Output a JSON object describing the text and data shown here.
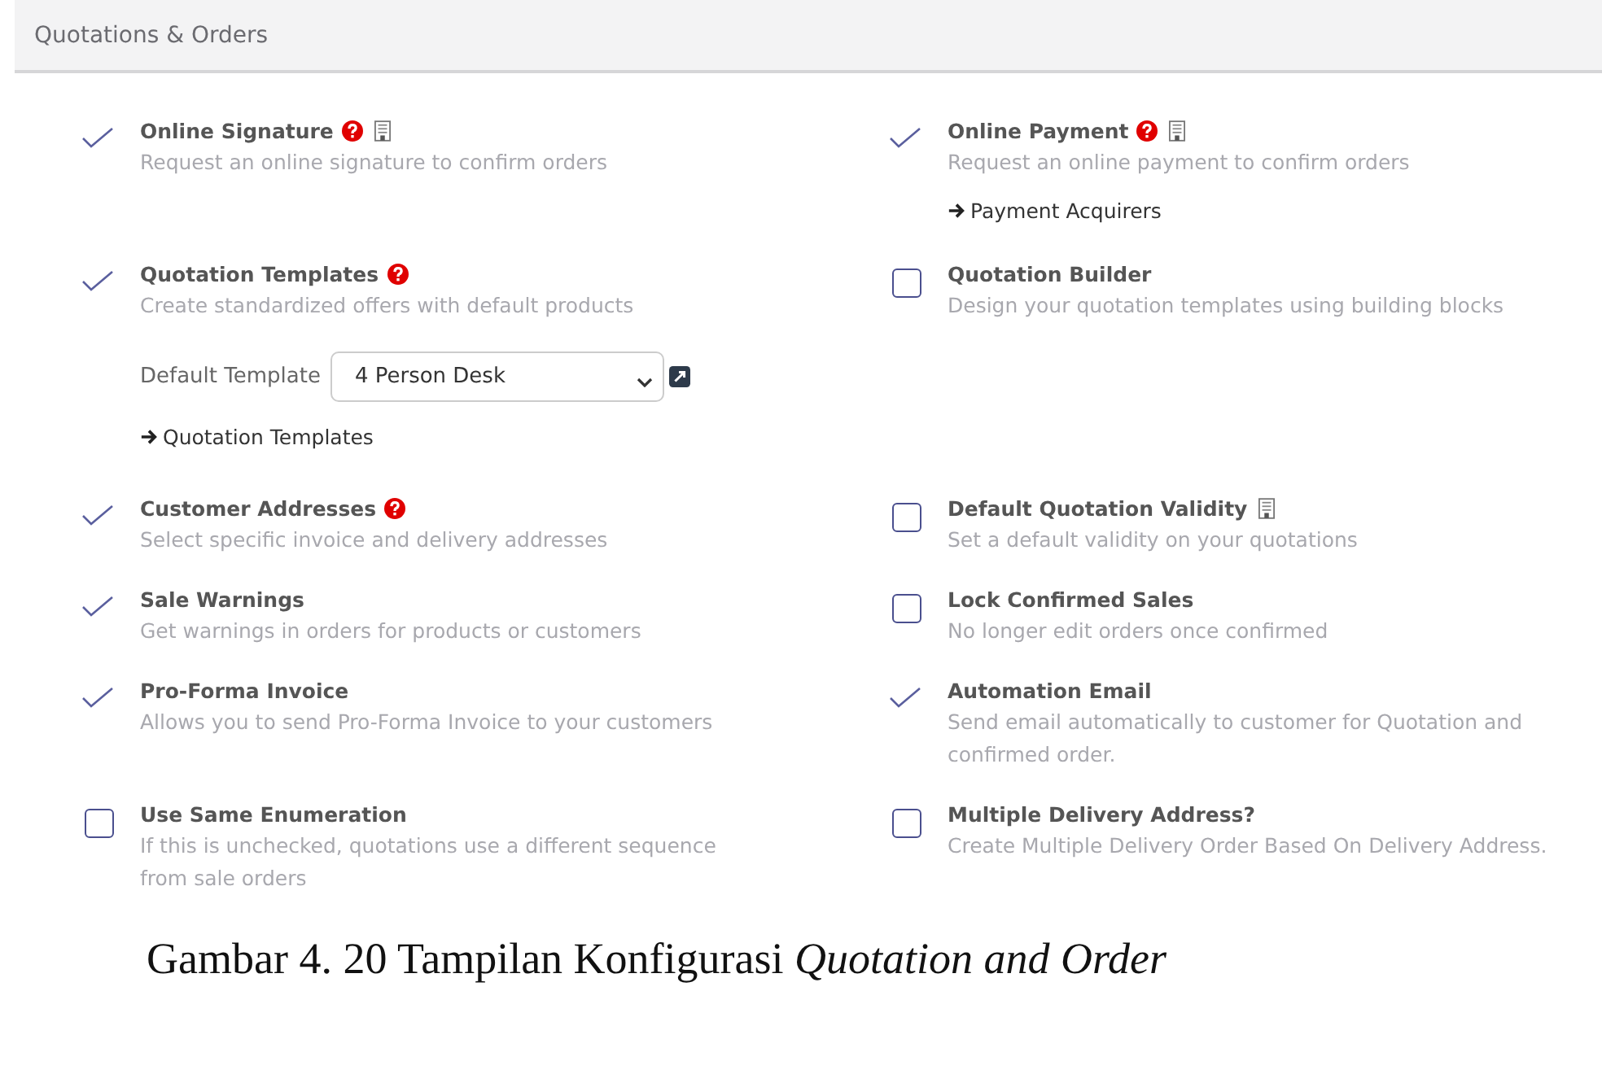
{
  "section": {
    "title": "Quotations & Orders"
  },
  "settings": [
    {
      "title": "Online Signature",
      "help": true,
      "enterprise": true,
      "checked": true,
      "description": "Request an online signature to confirm orders"
    },
    {
      "title": "Online Payment",
      "help": true,
      "enterprise": true,
      "checked": true,
      "description": "Request an online payment to confirm orders",
      "link": "Payment Acquirers"
    },
    {
      "title": "Quotation Templates",
      "help": true,
      "enterprise": false,
      "checked": true,
      "description": "Create standardized offers with default products",
      "field": {
        "label": "Default Template",
        "value": "4 Person Desk"
      },
      "link": "Quotation Templates"
    },
    {
      "title": "Quotation Builder",
      "help": false,
      "enterprise": false,
      "checked": false,
      "description": "Design your quotation templates using building blocks"
    },
    {
      "title": "Customer Addresses",
      "help": true,
      "enterprise": false,
      "checked": true,
      "description": "Select specific invoice and delivery addresses"
    },
    {
      "title": "Default Quotation Validity",
      "help": false,
      "enterprise": true,
      "checked": false,
      "description": "Set a default validity on your quotations"
    },
    {
      "title": "Sale Warnings",
      "help": false,
      "enterprise": false,
      "checked": true,
      "description": "Get warnings in orders for products or customers"
    },
    {
      "title": "Lock Confirmed Sales",
      "help": false,
      "enterprise": false,
      "checked": false,
      "description": "No longer edit orders once confirmed"
    },
    {
      "title": "Pro-Forma Invoice",
      "help": false,
      "enterprise": false,
      "checked": true,
      "description": "Allows you to send Pro-Forma Invoice to your customers"
    },
    {
      "title": "Automation Email",
      "help": false,
      "enterprise": false,
      "checked": true,
      "description": "Send email automatically to customer for Quotation and confirmed order."
    },
    {
      "title": "Use Same Enumeration",
      "help": false,
      "enterprise": false,
      "checked": false,
      "description": "If this is unchecked, quotations use a different sequence from sale orders"
    },
    {
      "title": "Multiple Delivery Address?",
      "help": false,
      "enterprise": false,
      "checked": false,
      "description": "Create Multiple Delivery Order Based On Delivery Address."
    }
  ],
  "caption": {
    "text": "Gambar 4. 20 Tampilan Konfigurasi *Quotation and Order*"
  }
}
